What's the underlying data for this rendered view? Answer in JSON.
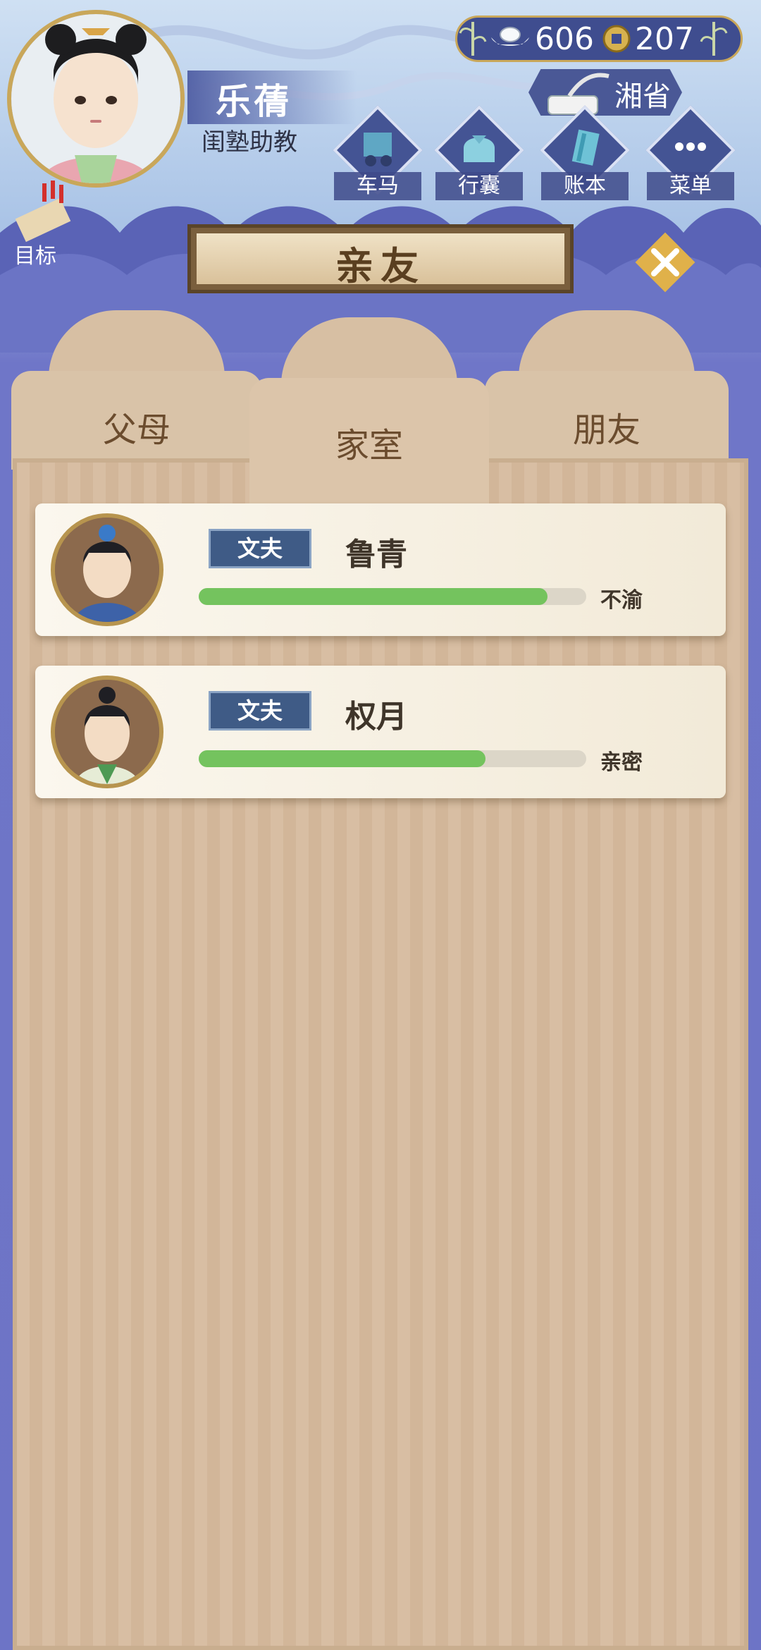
{
  "player": {
    "name": "乐蒨",
    "title": "闺塾助教"
  },
  "currency": {
    "silver": "606",
    "copper": "207"
  },
  "province": "湘省",
  "top_menu": [
    {
      "label": "车马",
      "icon": "carriage-icon"
    },
    {
      "label": "行囊",
      "icon": "bundle-icon"
    },
    {
      "label": "账本",
      "icon": "ledger-icon"
    },
    {
      "label": "菜单",
      "icon": "more-icon"
    }
  ],
  "goal_label": "目标",
  "banner_title": "亲友",
  "tabs": [
    {
      "label": "父母",
      "active": false
    },
    {
      "label": "家室",
      "active": true
    },
    {
      "label": "朋友",
      "active": false
    }
  ],
  "relations": [
    {
      "relation": "文夫",
      "name": "鲁青",
      "affinity": 0.9,
      "mood": "不渝"
    },
    {
      "relation": "文夫",
      "name": "权月",
      "affinity": 0.74,
      "mood": "亲密"
    }
  ],
  "colors": {
    "bar_fill": "#74c35e",
    "panel": "#d8bea3",
    "accent_gold": "#c9a75a",
    "navy": "#3f4d8f"
  }
}
